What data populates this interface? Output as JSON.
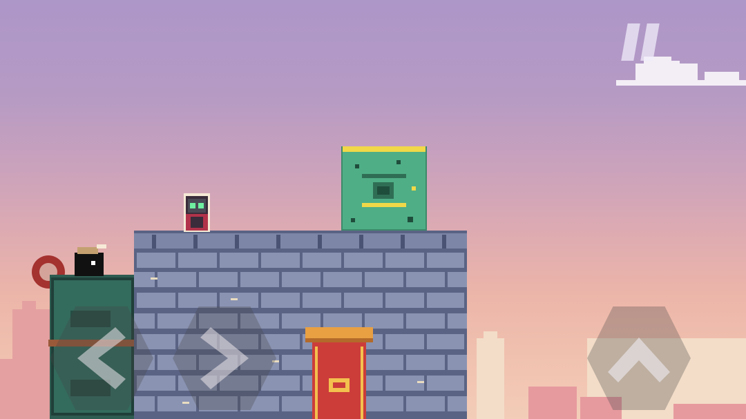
{
  "scene": {
    "name": "rooftop-level",
    "sky_top_color": "#ad96c8",
    "sky_bottom_color": "#f3cdb8",
    "wall_color": "#7d86a6",
    "brick_line_color": "#5a6384",
    "block_color": "#4fae86",
    "block_top_color": "#f1d848",
    "door_color": "#cc3d3a",
    "door_trim_color": "#e8a043"
  },
  "controls": {
    "pause_icon": "pause-icon",
    "left_icon": "chevron-left-icon",
    "right_icon": "chevron-right-icon",
    "jump_icon": "chevron-up-icon"
  }
}
